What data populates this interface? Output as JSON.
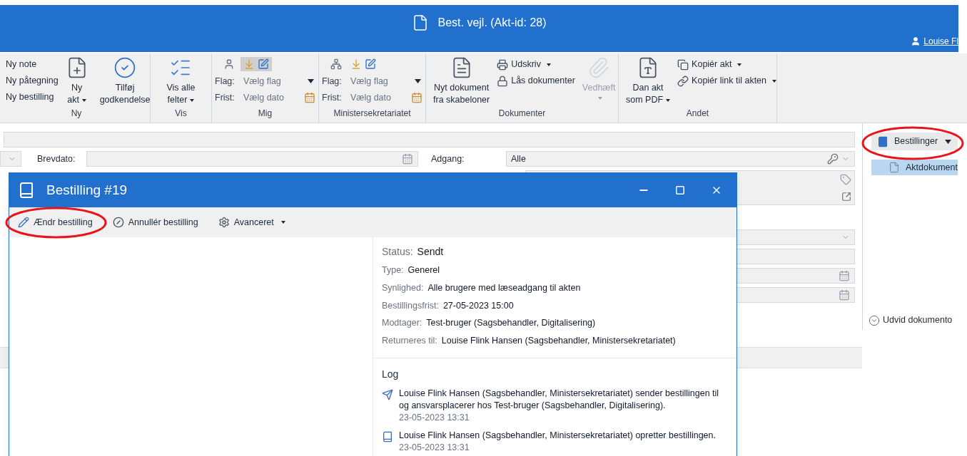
{
  "window": {
    "title": "Best. vejl.",
    "subtitle": "(Akt-id: 28)",
    "user": "Louise Fl"
  },
  "ribbon": {
    "ny": {
      "label": "Ny",
      "links": [
        "Ny note",
        "Ny påtegning",
        "Ny bestilling"
      ],
      "buttons": [
        {
          "kind": "new-doc",
          "lines": [
            "Ny",
            "akt"
          ],
          "dropdown": true,
          "disabled": false
        },
        {
          "kind": "approve",
          "lines": [
            "Tilføj",
            "godkendelse"
          ],
          "dropdown": false,
          "disabled": false
        }
      ]
    },
    "vis": {
      "label": "Vis",
      "button": {
        "kind": "fields",
        "lines": [
          "Vis alle",
          "felter"
        ],
        "dropdown": true,
        "disabled": false
      }
    },
    "flags": [
      {
        "label": "Mig",
        "kind": "person",
        "highlighted": true,
        "flag_label": "Flag:",
        "flag_value": "Vælg flag",
        "frist_label": "Frist:",
        "frist_value": "Vælg dato"
      },
      {
        "label": "Ministersekretariatet",
        "kind": "org",
        "highlighted": false,
        "flag_label": "Flag:",
        "flag_value": "Vælg flag",
        "frist_label": "Frist:",
        "frist_value": "Vælg dato"
      }
    ],
    "dokumenter": {
      "label": "Dokumenter",
      "big": {
        "kind": "template",
        "lines": [
          "Nyt dokument",
          "fra skabeloner"
        ],
        "dropdown": false,
        "disabled": false
      },
      "small": [
        {
          "kind": "print",
          "text": "Udskriv",
          "dropdown": true
        },
        {
          "kind": "lock",
          "text": "Lås dokumenter",
          "dropdown": false
        }
      ],
      "attach": {
        "kind": "attach",
        "lines": [
          "Vedhæft"
        ],
        "dropdown": true,
        "disabled": true
      }
    },
    "andet": {
      "label": "Andet",
      "big": {
        "kind": "pdf",
        "lines": [
          "Dan akt",
          "som PDF"
        ],
        "dropdown": true,
        "disabled": false
      },
      "small": [
        {
          "kind": "copy",
          "text": "Kopiér akt",
          "dropdown": true
        },
        {
          "kind": "link",
          "text": "Kopiér link til akten",
          "dropdown": true
        }
      ]
    }
  },
  "form": {
    "brevdato_label": "Brevdato:",
    "adgang_label": "Adgang:",
    "adgang_value": "Alle"
  },
  "side_panel": {
    "button": "Bestillinger",
    "items": [
      {
        "label": "Aktdokument",
        "selected": true
      }
    ],
    "expand": "Udvid dokumento"
  },
  "dialog": {
    "title": "Bestilling #19",
    "toolbar": [
      {
        "kind": "edit",
        "label": "Ændr bestilling",
        "dropdown": false
      },
      {
        "kind": "cancel",
        "label": "Annullér bestilling",
        "dropdown": false
      },
      {
        "kind": "settings",
        "label": "Avanceret",
        "dropdown": true
      }
    ],
    "details": [
      {
        "kind": "status",
        "label": "Status:",
        "value": "Sendt"
      },
      {
        "kind": "plain",
        "label": "Type:",
        "value": "Generel"
      },
      {
        "kind": "plain",
        "label": "Synlighed:",
        "value": "Alle brugere med læseadgang til akten"
      },
      {
        "kind": "plain",
        "label": "Bestillingsfrist:",
        "value": "27-05-2023 15:00"
      },
      {
        "kind": "plain",
        "label": "Modtager:",
        "value": "Test-bruger (Sagsbehandler, Digitalisering)"
      },
      {
        "kind": "plain",
        "label": "Returneres til:",
        "value": "Louise Flink Hansen (Sagsbehandler, Ministersekretariatet)"
      }
    ],
    "log_title": "Log",
    "log": [
      {
        "kind": "sent",
        "text": "Louise Flink Hansen (Sagsbehandler, Ministersekretariatet) sender bestillingen til og ansvarsplacerer hos Test-bruger (Sagsbehandler, Digitalisering).",
        "time": "23-05-2023 13:31"
      },
      {
        "kind": "created",
        "text": "Louise Flink Hansen (Sagsbehandler, Ministersekretariatet) opretter bestillingen.",
        "time": "23-05-2023 13:31"
      }
    ]
  }
}
